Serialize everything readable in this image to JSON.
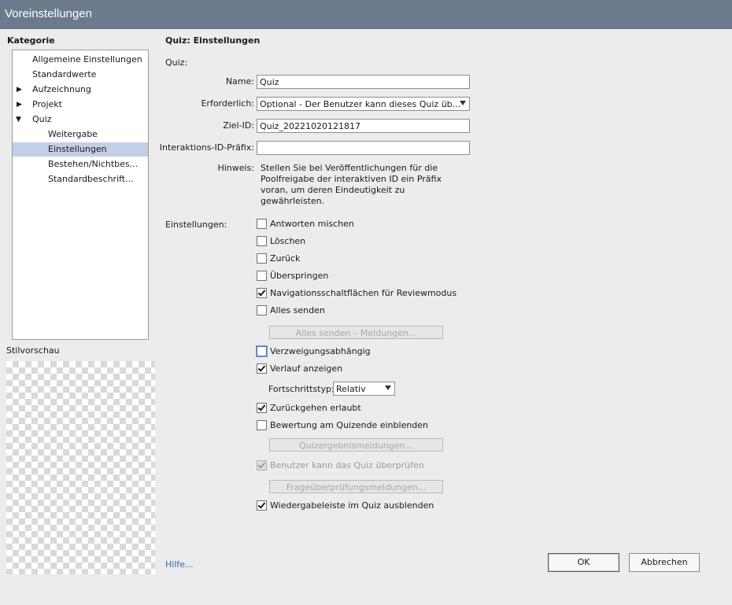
{
  "window": {
    "title": "Voreinstellungen"
  },
  "sidebar": {
    "heading": "Kategorie",
    "items": [
      {
        "label": "Allgemeine Einstellungen",
        "level": 0
      },
      {
        "label": "Standardwerte",
        "level": 0
      },
      {
        "label": "Aufzeichnung",
        "level": 0,
        "arrow": "▶"
      },
      {
        "label": "Projekt",
        "level": 0,
        "arrow": "▶"
      },
      {
        "label": "Quiz",
        "level": 0,
        "arrow": "▼"
      },
      {
        "label": "Weitergabe",
        "level": 1
      },
      {
        "label": "Einstellungen",
        "level": 1,
        "selected": true
      },
      {
        "label": "Bestehen/Nichtbes...",
        "level": 1
      },
      {
        "label": "Standardbeschrift...",
        "level": 1
      }
    ],
    "preview_label": "Stilvorschau"
  },
  "main": {
    "title": "Quiz: Einstellungen",
    "section_quiz": "Quiz:",
    "name_label": "Name:",
    "name_value": "Quiz",
    "required_label": "Erforderlich:",
    "required_value": "Optional - Der Benutzer kann dieses Quiz üb...",
    "target_label": "Ziel-ID:",
    "target_value": "Quiz_20221020121817",
    "prefix_label": "Interaktions-ID-Präfix:",
    "prefix_value": "",
    "hint_label": "Hinweis:",
    "hint_lines": [
      "Stellen Sie bei Veröffentlichungen für die",
      "Poolfreigabe der interaktiven ID ein Präfix",
      "voran, um deren Eindeutigkeit zu",
      "gewährleisten."
    ],
    "settings_label": "Einstellungen:",
    "options": {
      "shuffle": "Antworten mischen",
      "clear": "Löschen",
      "back": "Zurück",
      "skip": "Überspringen",
      "review_nav": "Navigationsschaltflächen für Reviewmodus",
      "submit_all": "Alles senden",
      "branch": "Verzweigungsabhängig",
      "show_progress": "Verlauf anzeigen",
      "allow_back": "Zurückgehen erlaubt",
      "show_score": "Bewertung am Quizende einblenden",
      "review_quiz": "Benutzer kann das Quiz überprüfen",
      "hide_playbar": "Wiedergabeleiste im Quiz ausblenden"
    },
    "submit_all_messages": "Alles senden – Meldungen...",
    "progress_type_label": "Fortschrittstyp:",
    "progress_type_value": "Relativ",
    "result_messages": "Quizergebnismeldungen...",
    "review_messages": "Frageüberprüfungsmeldungen..."
  },
  "footer": {
    "help": "Hilfe...",
    "ok": "OK",
    "cancel": "Abbrechen"
  }
}
